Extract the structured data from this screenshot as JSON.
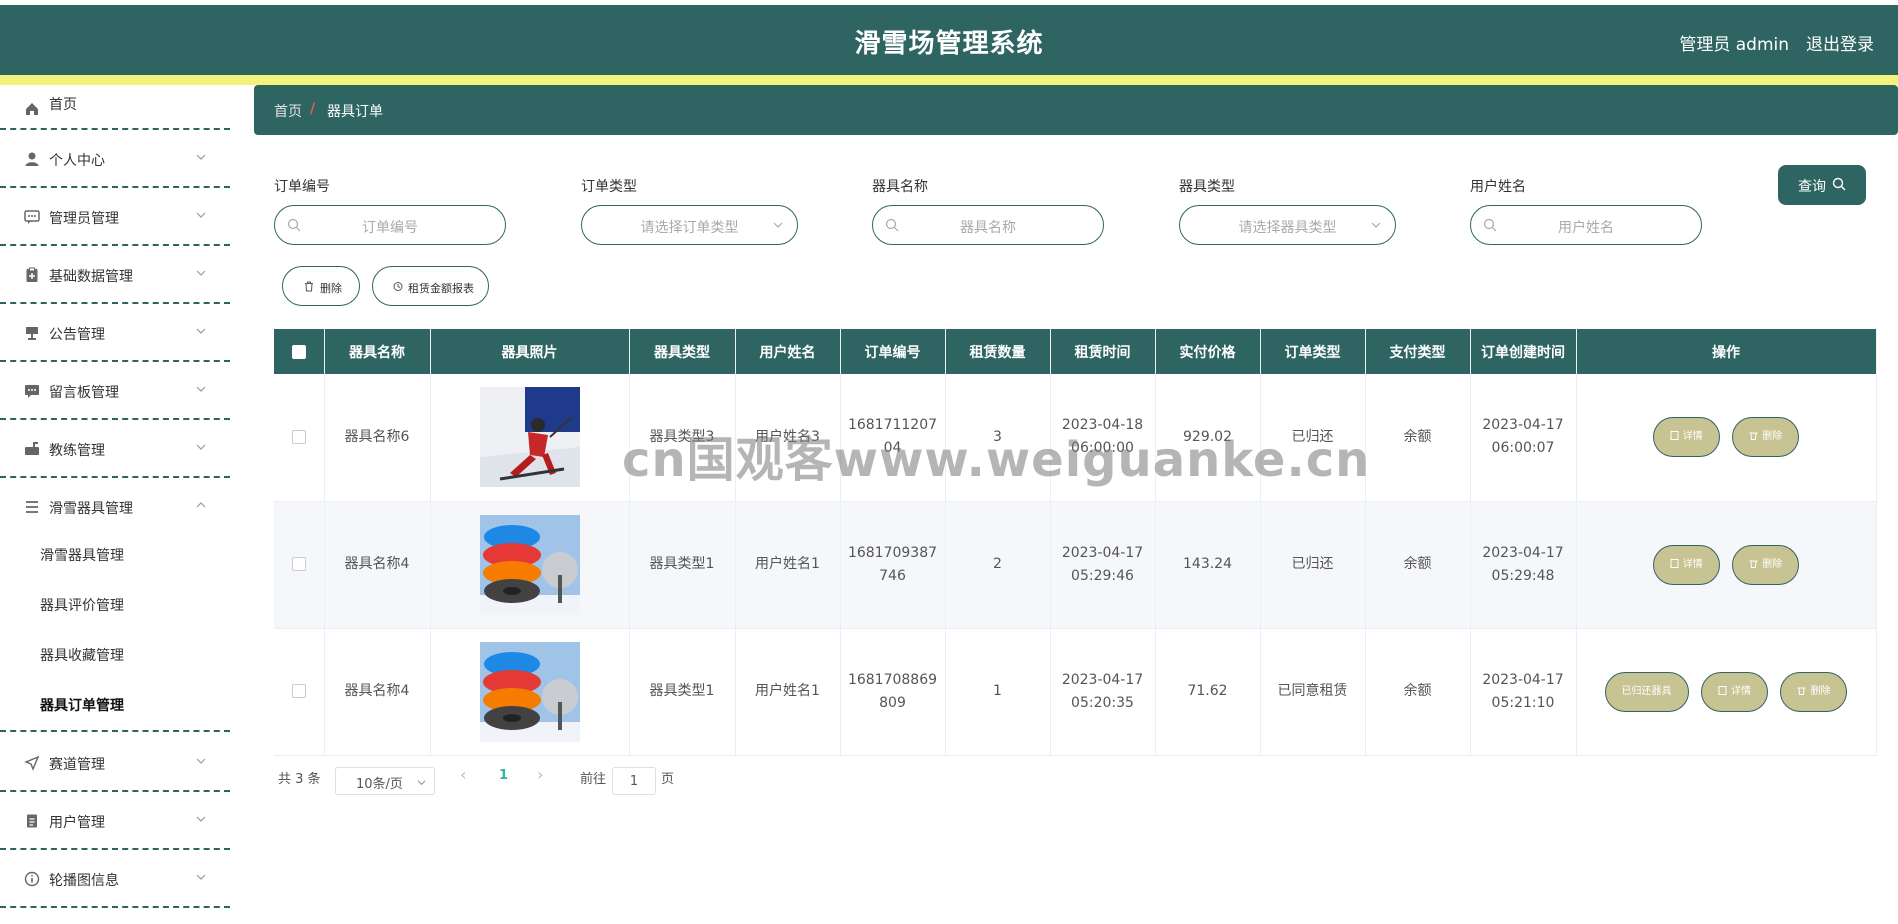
{
  "header": {
    "title": "滑雪场管理系统",
    "user_label": "管理员 admin",
    "logout_label": "退出登录"
  },
  "sidebar": {
    "items": [
      {
        "label": "首页",
        "icon": "home-icon"
      },
      {
        "label": "个人中心",
        "icon": "person-icon"
      },
      {
        "label": "管理员管理",
        "icon": "chat-icon"
      },
      {
        "label": "基础数据管理",
        "icon": "clipboard-icon"
      },
      {
        "label": "公告管理",
        "icon": "signpost-icon"
      },
      {
        "label": "留言板管理",
        "icon": "message-icon"
      },
      {
        "label": "教练管理",
        "icon": "mailbox-icon"
      },
      {
        "label": "滑雪器具管理",
        "icon": "list-icon",
        "expanded": true,
        "children": [
          "滑雪器具管理",
          "器具评价管理",
          "器具收藏管理",
          "器具订单管理"
        ],
        "active_child": "器具订单管理"
      },
      {
        "label": "赛道管理",
        "icon": "send-icon"
      },
      {
        "label": "用户管理",
        "icon": "document-icon"
      },
      {
        "label": "轮播图信息",
        "icon": "info-icon"
      }
    ]
  },
  "breadcrumb": {
    "home": "首页",
    "separator": "/",
    "current": "器具订单"
  },
  "search": {
    "order_no": {
      "label": "订单编号",
      "placeholder": "订单编号"
    },
    "order_type": {
      "label": "订单类型",
      "placeholder": "请选择订单类型"
    },
    "item_name": {
      "label": "器具名称",
      "placeholder": "器具名称"
    },
    "item_type": {
      "label": "器具类型",
      "placeholder": "请选择器具类型"
    },
    "user_name": {
      "label": "用户姓名",
      "placeholder": "用户姓名"
    },
    "query_label": "查询"
  },
  "actions": {
    "delete_label": "删除",
    "report_label": "租赁金额报表"
  },
  "table": {
    "headers": [
      "器具名称",
      "器具照片",
      "器具类型",
      "用户姓名",
      "订单编号",
      "租赁数量",
      "租赁时间",
      "实付价格",
      "订单类型",
      "支付类型",
      "订单创建时间",
      "操作"
    ],
    "rows": [
      {
        "name": "器具名称6",
        "photo": "skier-photo",
        "type": "器具类型3",
        "user": "用户姓名3",
        "order_no_1": "1681711207",
        "order_no_2": "04",
        "qty": "3",
        "rent_date": "2023-04-18",
        "rent_time": "06:00:00",
        "price": "929.02",
        "order_type": "已归还",
        "pay_type": "余额",
        "created_date": "2023-04-17",
        "created_time": "06:00:07",
        "buttons": [
          "详情",
          "删除"
        ]
      },
      {
        "name": "器具名称4",
        "photo": "snow-tube-photo",
        "type": "器具类型1",
        "user": "用户姓名1",
        "order_no_1": "1681709387",
        "order_no_2": "746",
        "qty": "2",
        "rent_date": "2023-04-17",
        "rent_time": "05:29:46",
        "price": "143.24",
        "order_type": "已归还",
        "pay_type": "余额",
        "created_date": "2023-04-17",
        "created_time": "05:29:48",
        "buttons": [
          "详情",
          "删除"
        ]
      },
      {
        "name": "器具名称4",
        "photo": "snow-tube-photo",
        "type": "器具类型1",
        "user": "用户姓名1",
        "order_no_1": "1681708869",
        "order_no_2": "809",
        "qty": "1",
        "rent_date": "2023-04-17",
        "rent_time": "05:20:35",
        "price": "71.62",
        "order_type": "已同意租赁",
        "pay_type": "余额",
        "created_date": "2023-04-17",
        "created_time": "05:21:10",
        "buttons": [
          "已归还器具",
          "详情",
          "删除"
        ]
      }
    ]
  },
  "pagination": {
    "total": "共 3 条",
    "page_size": "10条/页",
    "current_page": "1",
    "goto_prefix": "前往",
    "goto_value": "1",
    "goto_suffix": "页"
  },
  "watermark": "cn国观客www.weiguanke.cn",
  "colors": {
    "primary": "#2e6461",
    "accent_yellow": "#f4f27a",
    "op_button": "#c7c393",
    "active_page": "#2fb59a"
  }
}
